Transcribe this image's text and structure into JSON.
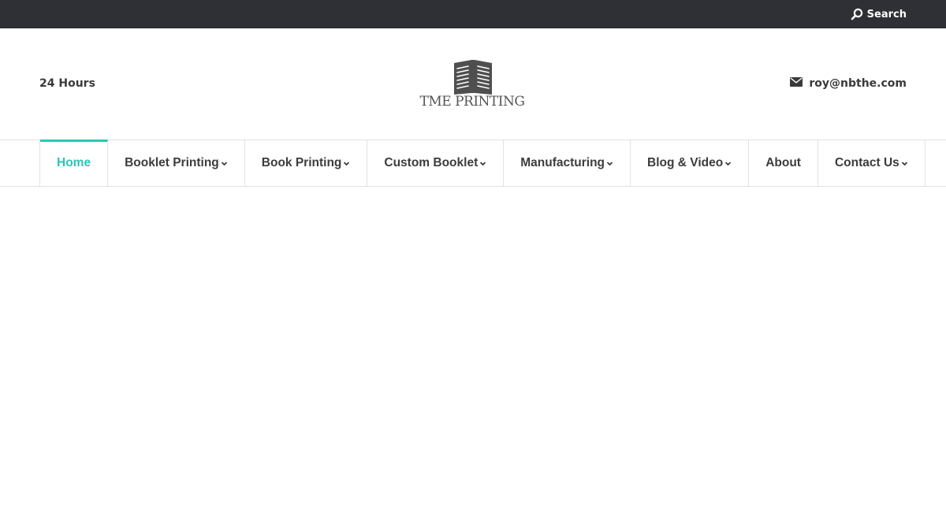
{
  "topbar": {
    "search_label": "Search",
    "search_icon": "search-icon"
  },
  "header": {
    "hours_text": "24 Hours",
    "logo_text": "TME PRINTING",
    "logo_icon": "open-book-icon",
    "email_icon": "envelope-icon",
    "email": "roy@nbthe.com"
  },
  "nav": {
    "items": [
      {
        "label": "Home",
        "active": true,
        "has_dropdown": false
      },
      {
        "label": "Booklet Printing",
        "active": false,
        "has_dropdown": true
      },
      {
        "label": "Book Printing",
        "active": false,
        "has_dropdown": true
      },
      {
        "label": "Custom Booklet",
        "active": false,
        "has_dropdown": true
      },
      {
        "label": "Manufacturing",
        "active": false,
        "has_dropdown": true
      },
      {
        "label": "Blog & Video",
        "active": false,
        "has_dropdown": true
      },
      {
        "label": "About",
        "active": false,
        "has_dropdown": false
      },
      {
        "label": "Contact Us",
        "active": false,
        "has_dropdown": true
      }
    ]
  },
  "colors": {
    "topbar_bg": "#2f3035",
    "accent": "#2ec4b6",
    "text": "#3c3c3c",
    "divider": "#e2e2e2"
  }
}
